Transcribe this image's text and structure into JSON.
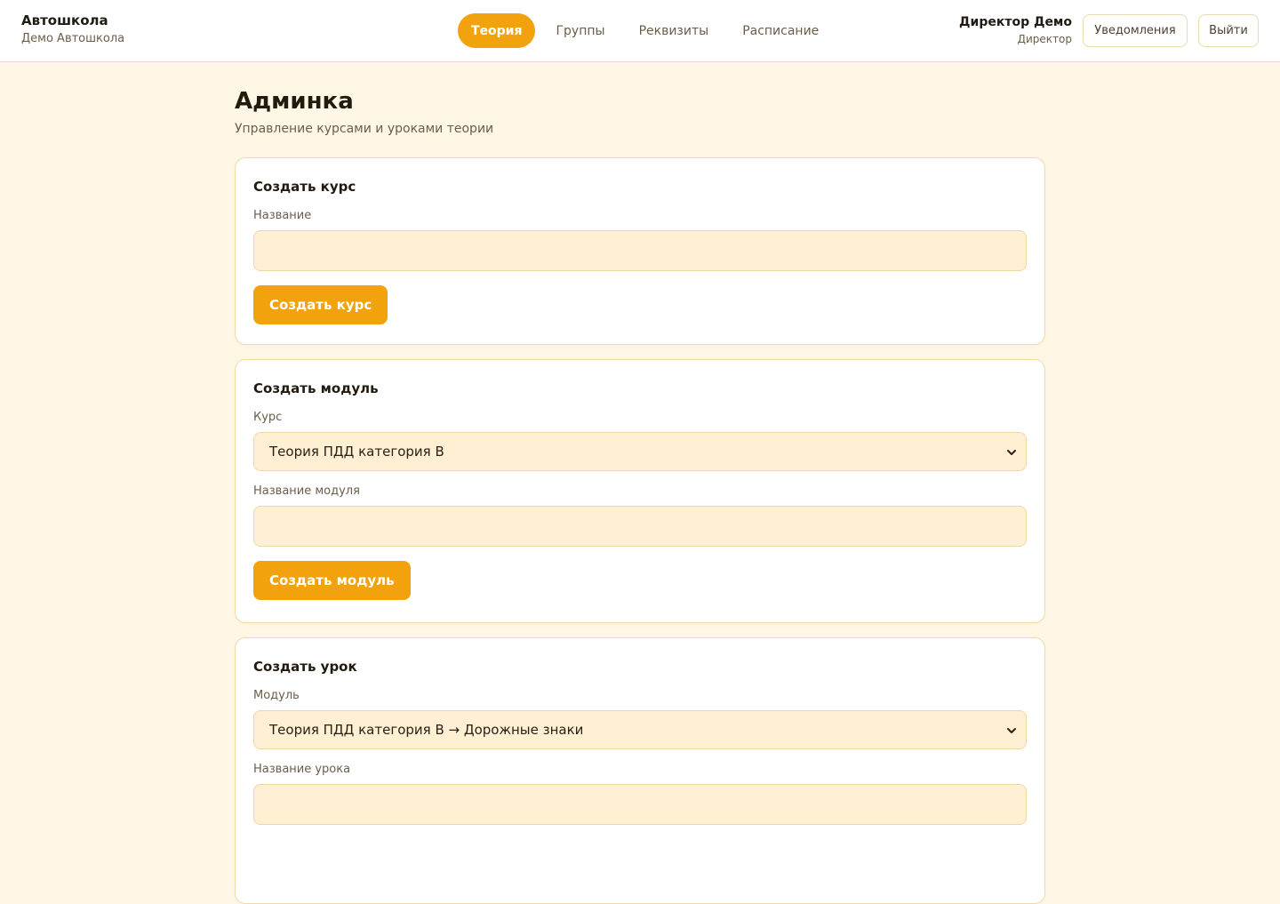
{
  "header": {
    "brand_title": "Автошкола",
    "brand_subtitle": "Демо Автошкола",
    "nav": [
      {
        "label": "Теория",
        "active": true
      },
      {
        "label": "Группы",
        "active": false
      },
      {
        "label": "Реквизиты",
        "active": false
      },
      {
        "label": "Расписание",
        "active": false
      }
    ],
    "user_name": "Директор Демо",
    "user_role": "Директор",
    "notifications_label": "Уведомления",
    "logout_label": "Выйти"
  },
  "page": {
    "title": "Админка",
    "subtitle": "Управление курсами и уроками теории"
  },
  "create_course": {
    "title": "Создать курс",
    "name_label": "Название",
    "name_value": "",
    "submit_label": "Создать курс"
  },
  "create_module": {
    "title": "Создать модуль",
    "course_label": "Курс",
    "course_selected": "Теория ПДД категория B",
    "name_label": "Название модуля",
    "name_value": "",
    "submit_label": "Создать модуль"
  },
  "create_lesson": {
    "title": "Создать урок",
    "module_label": "Модуль",
    "module_selected": "Теория ПДД категория B → Дорожные знаки",
    "name_label": "Название урока",
    "name_value": ""
  },
  "colors": {
    "accent": "#f2a20c",
    "page_background": "#fff7e6",
    "input_background": "#fff0d4",
    "border": "#f0d9ad"
  },
  "icons": {
    "select_chevron": "chevron-down-icon"
  }
}
